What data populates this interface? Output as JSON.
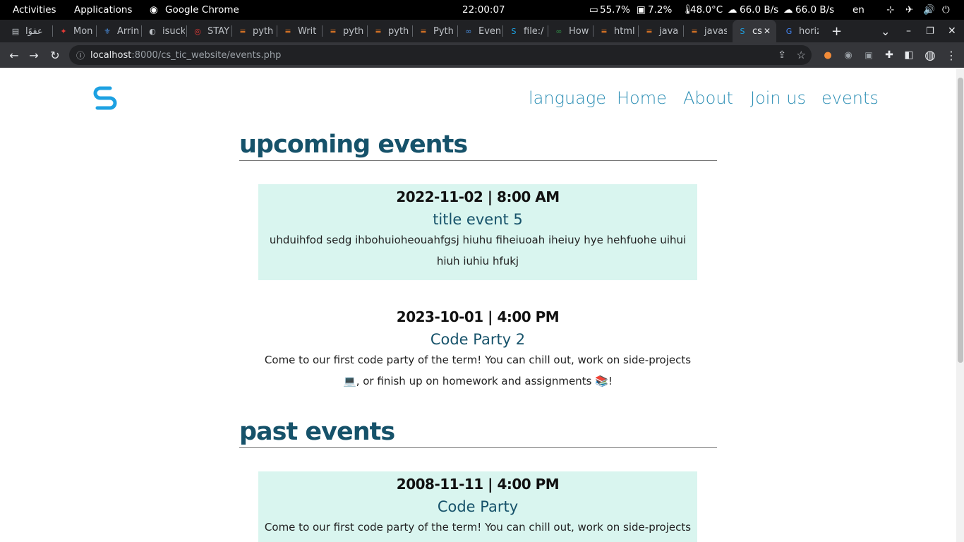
{
  "system_bar": {
    "activities": "Activities",
    "applications": "Applications",
    "app_name": "Google Chrome",
    "clock": "22:00:07",
    "battery": "55.7%",
    "memory": "7.2%",
    "temperature": "48.0°C",
    "download": "66.0 B/s",
    "upload": "66.0 B/s",
    "language": "en"
  },
  "tabs": [
    {
      "label": "عفوًا",
      "icon": "page-icon"
    },
    {
      "label": "Mon",
      "icon": "maple-icon"
    },
    {
      "label": "Arrin",
      "icon": "quebec-flag-icon"
    },
    {
      "label": "isuck",
      "icon": "github-icon"
    },
    {
      "label": "STAY",
      "icon": "target-icon"
    },
    {
      "label": "pyth",
      "icon": "stackoverflow-icon"
    },
    {
      "label": "Writ",
      "icon": "stackoverflow-icon"
    },
    {
      "label": "pyth",
      "icon": "stackoverflow-icon"
    },
    {
      "label": "pyth",
      "icon": "stackoverflow-icon"
    },
    {
      "label": "Pyth",
      "icon": "stackoverflow-icon"
    },
    {
      "label": "Even",
      "icon": "w3-icon"
    },
    {
      "label": "file:/",
      "icon": "site-logo-icon"
    },
    {
      "label": "How",
      "icon": "geeks-icon"
    },
    {
      "label": "html",
      "icon": "stackoverflow-icon"
    },
    {
      "label": "java",
      "icon": "stackoverflow-icon"
    },
    {
      "label": "javas",
      "icon": "stackoverflow-icon"
    },
    {
      "label": "cs",
      "icon": "site-logo-icon",
      "active": true
    },
    {
      "label": "horiz",
      "icon": "google-icon"
    }
  ],
  "address_bar": {
    "host": "localhost",
    "path": ":8000/cs_tic_website/events.php"
  },
  "site": {
    "nav": [
      "language",
      "Home",
      "About",
      "Join us",
      "events"
    ],
    "upcoming_heading": "upcoming events",
    "past_heading": "past events",
    "upcoming": [
      {
        "date": "2022-11-02 | 8:00 AM",
        "title": "title event 5",
        "description": "uhduihfod sedg ihbohuioheouahfgsj hiuhu fiheiuoah iheiuy hye hehfuohe uihui hiuh iuhiu hfukj"
      },
      {
        "date": "2023-10-01 | 4:00 PM",
        "title": "Code Party 2",
        "description": "Come to our first code party of the term! You can chill out, work on side-projects 💻, or finish up on homework and assignments 📚!"
      }
    ],
    "past": [
      {
        "date": "2008-11-11 | 4:00 PM",
        "title": "Code Party",
        "description": "Come to our first code party of the term! You can chill out, work on side-projects 💻, or"
      }
    ]
  },
  "colors": {
    "heading": "#16526a",
    "nav": "#2d8fb5",
    "event_highlight": "#d9f5ef",
    "logo": "#1da1e2"
  }
}
